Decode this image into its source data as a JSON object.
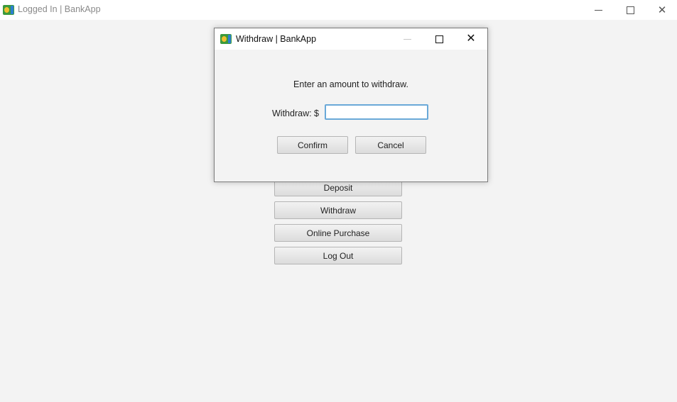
{
  "main_window": {
    "title": "Logged In  |  BankApp",
    "controls": {
      "minimize_icon": "minimize-icon",
      "maximize_icon": "maximize-icon",
      "close_icon": "close-icon"
    }
  },
  "menu": {
    "buttons": [
      {
        "label": "Deposit"
      },
      {
        "label": "Withdraw"
      },
      {
        "label": "Online Purchase"
      },
      {
        "label": "Log Out"
      }
    ]
  },
  "dialog": {
    "title": "Withdraw  |  BankApp",
    "prompt": "Enter an amount to withdraw.",
    "field_label": "Withdraw: $",
    "amount_value": "",
    "confirm_label": "Confirm",
    "cancel_label": "Cancel"
  },
  "colors": {
    "background": "#f3f3f3",
    "titlebar": "#ffffff",
    "focus_border": "#6aa9d8"
  }
}
